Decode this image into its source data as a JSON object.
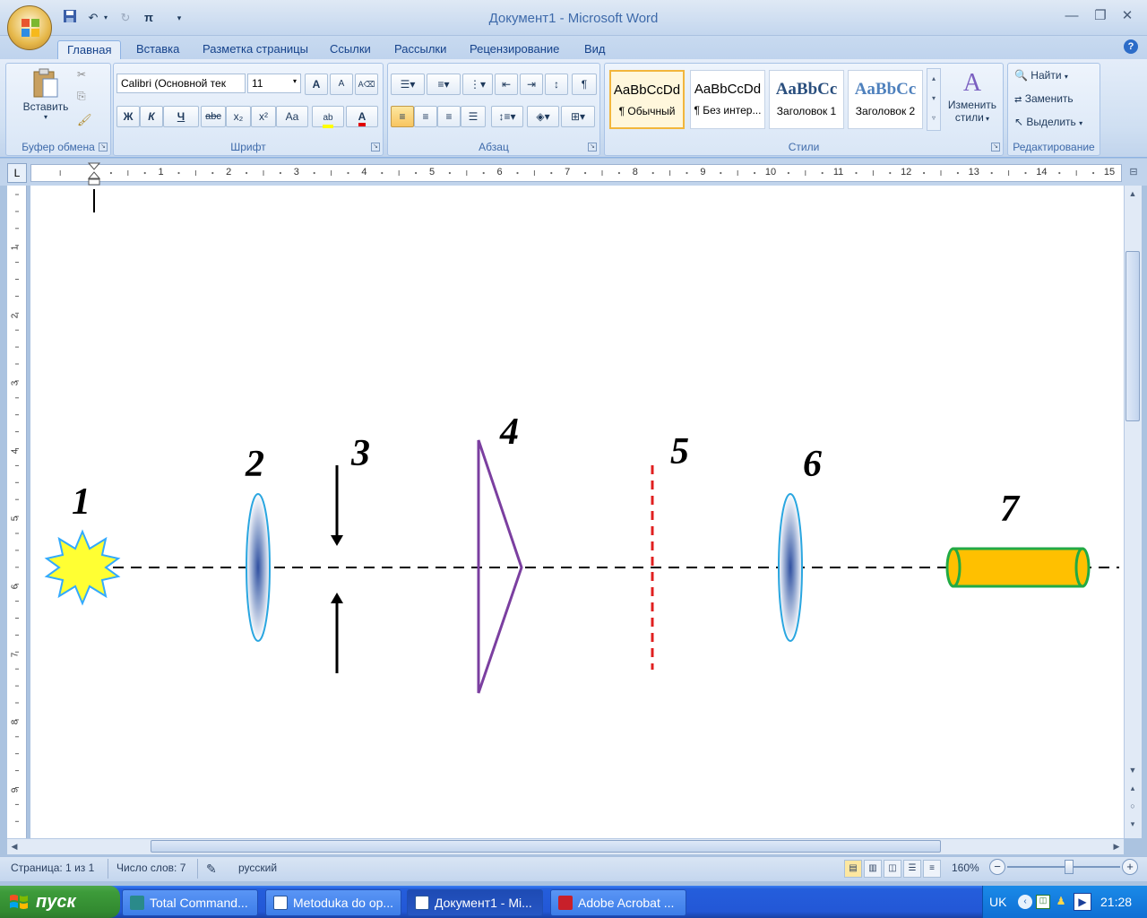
{
  "window": {
    "title": "Документ1 - Microsoft Word"
  },
  "tabs": [
    "Главная",
    "Вставка",
    "Разметка страницы",
    "Ссылки",
    "Рассылки",
    "Рецензирование",
    "Вид"
  ],
  "ribbon": {
    "clipboard": {
      "paste_label": "Вставить",
      "group_label": "Буфер обмена"
    },
    "font": {
      "font_name": "Calibri (Основной тек",
      "font_size": "11",
      "group_label": "Шрифт",
      "bold": "Ж",
      "italic": "К",
      "underline": "Ч",
      "strike": "abc",
      "subscript": "x₂",
      "superscript": "x²",
      "case": "Aa",
      "grow": "A",
      "shrink": "A"
    },
    "paragraph": {
      "group_label": "Абзац",
      "pilcrow": "¶"
    },
    "styles": {
      "group_label": "Стили",
      "items": [
        {
          "sample": "AaBbCcDd",
          "name": "¶ Обычный"
        },
        {
          "sample": "AaBbCcDd",
          "name": "¶ Без интер..."
        },
        {
          "sample": "AaBbCc",
          "name": "Заголовок 1"
        },
        {
          "sample": "AaBbCc",
          "name": "Заголовок 2"
        }
      ],
      "change_styles_line1": "Изменить",
      "change_styles_line2": "стили"
    },
    "editing": {
      "group_label": "Редактирование",
      "find": "Найти",
      "replace": "Заменить",
      "select": "Выделить"
    }
  },
  "ruler": {
    "tab_selector": "L",
    "h_numbers": [
      "1",
      "2",
      "3",
      "4",
      "5",
      "6",
      "7",
      "8",
      "9",
      "10",
      "11",
      "12",
      "13",
      "14",
      "15"
    ],
    "v_numbers": [
      "1",
      "2",
      "3",
      "4",
      "5",
      "6",
      "7",
      "8",
      "9"
    ]
  },
  "diagram": {
    "labels": [
      "1",
      "2",
      "3",
      "4",
      "5",
      "6",
      "7"
    ],
    "colors": {
      "axis": "#000000",
      "lens_edge": "#2aa6e0",
      "prism": "#7b3fa0",
      "screen": "#e02020",
      "detector_fill": "#ffc000",
      "detector_edge": "#22aa44",
      "source_fill": "#ffff33",
      "source_edge": "#33aaff"
    }
  },
  "status": {
    "page": "Страница: 1 из 1",
    "words": "Число слов: 7",
    "language": "русский",
    "zoom": "160%"
  },
  "taskbar": {
    "start": "пуск",
    "tasks": [
      "Total Command...",
      "Metoduka do op...",
      "Документ1 - Mi...",
      "Adobe Acrobat ..."
    ],
    "lang": "UK",
    "clock": "21:28"
  }
}
